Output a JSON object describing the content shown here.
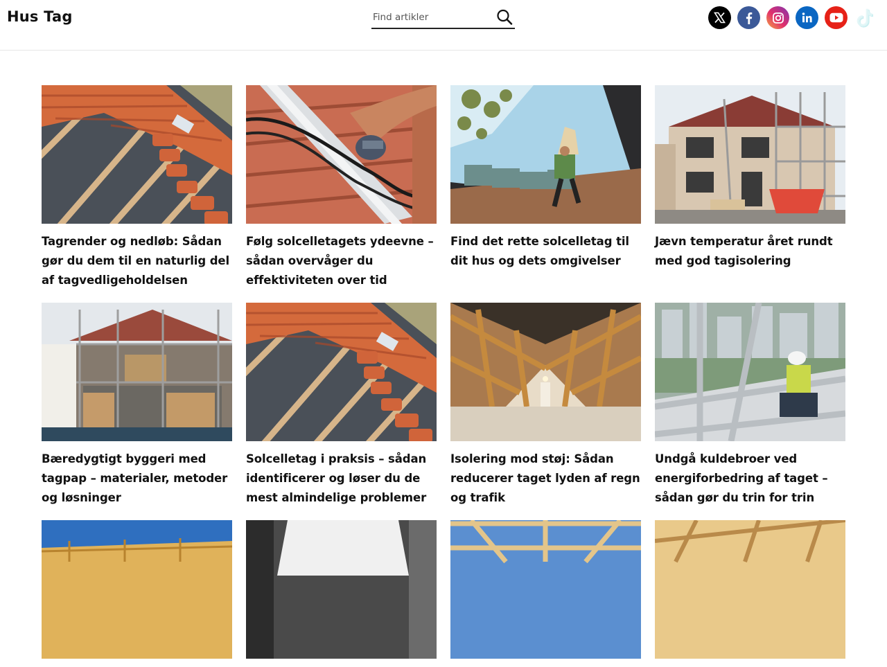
{
  "site": {
    "title": "Hus Tag"
  },
  "search": {
    "placeholder": "Find artikler",
    "value": ""
  },
  "social": [
    {
      "name": "x",
      "icon": "x-icon",
      "color": "#000000"
    },
    {
      "name": "facebook",
      "icon": "facebook-icon",
      "color": "#3b5998"
    },
    {
      "name": "instagram",
      "icon": "instagram-icon",
      "color": "#c13584"
    },
    {
      "name": "linkedin",
      "icon": "linkedin-icon",
      "color": "#0a66c2"
    },
    {
      "name": "youtube",
      "icon": "youtube-icon",
      "color": "#e62117"
    },
    {
      "name": "tiktok",
      "icon": "tiktok-icon",
      "color": "#c9eef0"
    }
  ],
  "articles": [
    {
      "title": "Tagrender og nedløb: Sådan gør du dem til en naturlig del af tagvedligeholdelsen",
      "image": "roof-tiles-installation"
    },
    {
      "title": "Følg solcelletagets ydeevne – sådan overvåger du effektiviteten over tid",
      "image": "solar-cable-on-tiles"
    },
    {
      "title": "Find det rette solcelletag til dit hus og dets omgivelser",
      "image": "worker-carrying-bag-on-roof"
    },
    {
      "title": "Jævn temperatur året rundt med god tagisolering",
      "image": "house-with-scaffolding"
    },
    {
      "title": "Bæredygtigt byggeri med tagpap – materialer, metoder og løsninger",
      "image": "extension-under-construction"
    },
    {
      "title": "Solcelletag i praksis – sådan identificerer og løser du de mest almindelige problemer",
      "image": "roof-tiles-installation"
    },
    {
      "title": "Isolering mod støj: Sådan reducerer taget lyden af regn og trafik",
      "image": "attic-timber-frame"
    },
    {
      "title": "Undgå kuldebroer ved energiforbedring af taget – sådan gør du trin for trin",
      "image": "worker-on-scaffolding-city"
    },
    {
      "title": "",
      "image": "roof-frame-blue-sky"
    },
    {
      "title": "",
      "image": "worker-white-shirt"
    },
    {
      "title": "",
      "image": "timber-trusses"
    },
    {
      "title": "",
      "image": "attic-insulation"
    }
  ]
}
